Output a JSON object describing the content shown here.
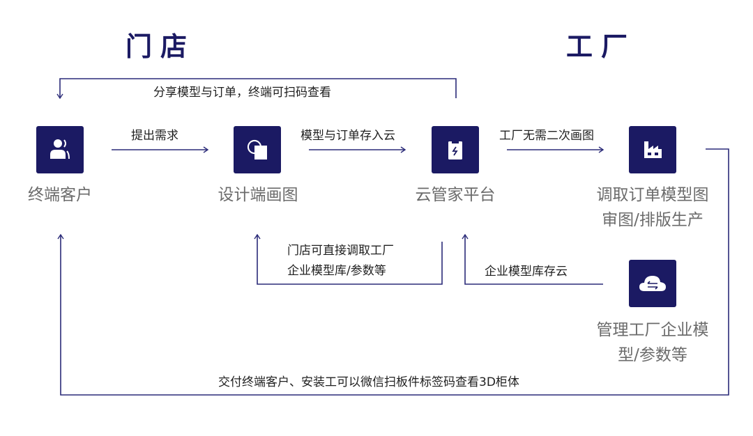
{
  "colors": {
    "primary": "#1b1a63",
    "line": "#2a2a78",
    "node_label": "#6b6b6b",
    "edge_label": "#1f1f1f"
  },
  "sections": {
    "store": "门店",
    "factory": "工厂"
  },
  "nodes": [
    {
      "id": "customer",
      "label": "终端客户",
      "icon": "user-group-icon"
    },
    {
      "id": "design",
      "label": "设计端画图",
      "icon": "shape-overlap-icon"
    },
    {
      "id": "cloud_platform",
      "label": "云管家平台",
      "icon": "clipboard-bolt-icon"
    },
    {
      "id": "factory_orders",
      "label_lines": [
        "调取订单模型图",
        "审图/排版生产"
      ],
      "icon": "factory-icon"
    },
    {
      "id": "factory_models",
      "label_lines": [
        "管理工厂企业模",
        "型/参数等"
      ],
      "icon": "cloud-sync-icon"
    }
  ],
  "edges": [
    {
      "from": "cloud_platform",
      "to": "customer",
      "label": "分享模型与订单，终端可扫码查看"
    },
    {
      "from": "customer",
      "to": "design",
      "label": "提出需求"
    },
    {
      "from": "design",
      "to": "cloud_platform",
      "label": "模型与订单存入云"
    },
    {
      "from": "cloud_platform",
      "to": "factory_orders",
      "label": "工厂无需二次画图"
    },
    {
      "from": "cloud_platform",
      "to": "design",
      "label_lines": [
        "门店可直接调取工厂",
        "企业模型库/参数等"
      ]
    },
    {
      "from": "factory_models",
      "to": "cloud_platform",
      "label": "企业模型库存云"
    },
    {
      "from": "factory_orders",
      "to": "customer",
      "label": "交付终端客户、安装工可以微信扫板件标签码查看3D柜体"
    }
  ]
}
